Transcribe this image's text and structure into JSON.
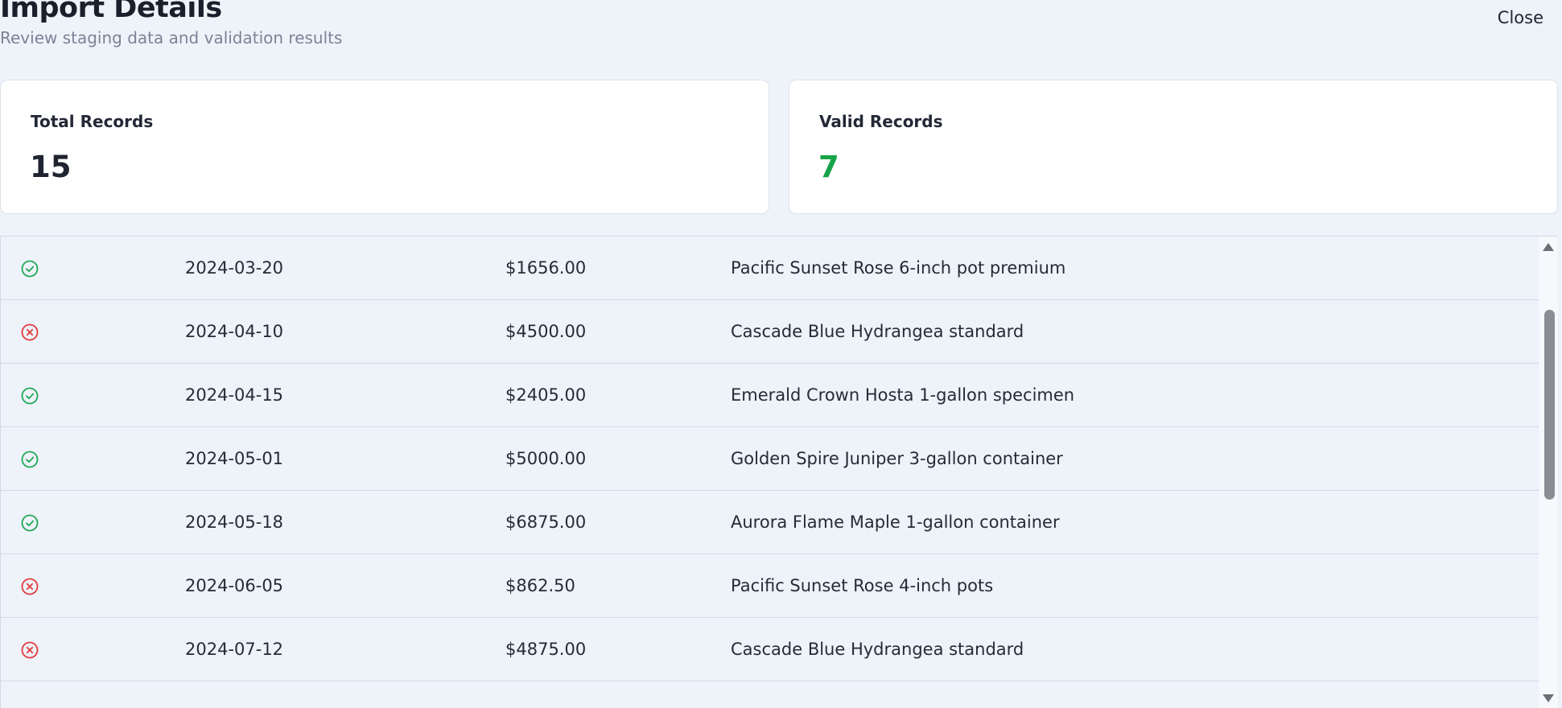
{
  "header": {
    "title": "Import Details",
    "subtitle": "Review staging data and validation results",
    "close_label": "Close"
  },
  "stats": {
    "total": {
      "label": "Total Records",
      "value": "15"
    },
    "valid": {
      "label": "Valid Records",
      "value": "7",
      "color": "#18a34a"
    }
  },
  "status_colors": {
    "valid": "#22a755",
    "invalid": "#e23b3b"
  },
  "records": [
    {
      "status": "valid",
      "icon": "check-circle-icon",
      "date": "2024-03-20",
      "amount": "$1656.00",
      "description": "Pacific Sunset Rose 6-inch pot premium"
    },
    {
      "status": "invalid",
      "icon": "x-circle-icon",
      "date": "2024-04-10",
      "amount": "$4500.00",
      "description": "Cascade Blue Hydrangea standard"
    },
    {
      "status": "valid",
      "icon": "check-circle-icon",
      "date": "2024-04-15",
      "amount": "$2405.00",
      "description": "Emerald Crown Hosta 1-gallon specimen"
    },
    {
      "status": "valid",
      "icon": "check-circle-icon",
      "date": "2024-05-01",
      "amount": "$5000.00",
      "description": "Golden Spire Juniper 3-gallon container"
    },
    {
      "status": "valid",
      "icon": "check-circle-icon",
      "date": "2024-05-18",
      "amount": "$6875.00",
      "description": "Aurora Flame Maple 1-gallon container"
    },
    {
      "status": "invalid",
      "icon": "x-circle-icon",
      "date": "2024-06-05",
      "amount": "$862.50",
      "description": "Pacific Sunset Rose 4-inch pots"
    },
    {
      "status": "invalid",
      "icon": "x-circle-icon",
      "date": "2024-07-12",
      "amount": "$4875.00",
      "description": "Cascade Blue Hydrangea standard"
    }
  ]
}
